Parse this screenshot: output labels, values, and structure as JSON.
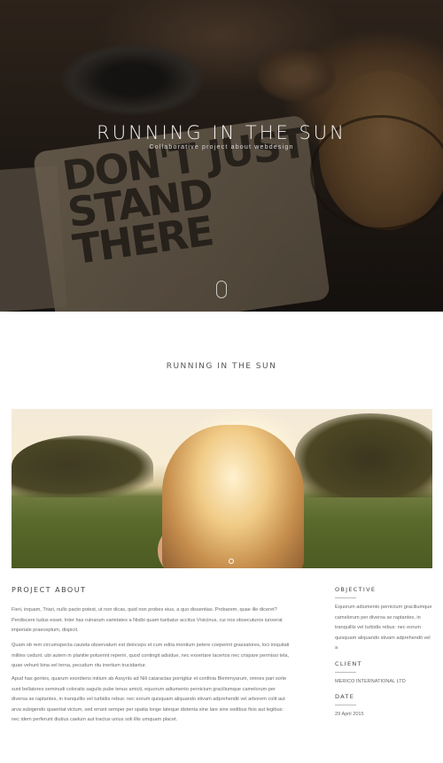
{
  "hero": {
    "title": "RUNNING IN THE SUN",
    "subtitle": "Collaborative project about webdesign",
    "coaster_text": "DON'T JUST STAND THERE"
  },
  "section": {
    "title": "RUNNING IN THE SUN"
  },
  "about": {
    "heading": "PROJECT ABOUT",
    "paragraphs": [
      "Fieri, inquam, Triari, nullo pacto potest, ut non dicas, quid non probes eius, a quo dissentias. Probarem, quae ille diceret? Perdiscere ludus esset. Inter has ruinarum varietates a Nisibi quam tuebatur accitus Vrsicinus, cui nos obsecuturos iunxerat imperiale praeceptum, dispicit.",
      "Quam ob rem circumspecta cautela observatum est deinceps et cum edita montium petere coeperint grassatores, loci iniquitati milites cedunt. ubi autem in planitie potuerint reperiri, quod contingit adsidue, nec exsertare lacertos nec crispare permissi tela, quae vehunt bina vel terna, pecudum ritu inertium trucidantur.",
      "Apud has gentes, quarum exordiens initium ab Assyriis ad Nili cataractas porrigitur et confinia Blemmyarum, omnes pari sorte sunt bellatores seminudi coloratis sagulis pube tenus amicti, equorum adiumento pernicium graciliumque camelorum per diversa se raptantes, in tranquillis vel turbidis rebus: nec eorum quisquam aliquando stivam adprehendit vel arborem colit aut arva subigendo quaeritat victum, sed errant semper per spatia longe lateque distenta sine lare sine sedibus fixis aut legibus: nec idem perferunt diutius caelum aut tractus unius soli illis umquam placet."
    ]
  },
  "sidebar": {
    "objective_label": "OBJECTIVE",
    "objective_value": "Equorum adiumento pernicium graciliumque camelorum per diversa se raptantes, in tranquillis vel turbidis rebus: nec eorum quisquam aliquando stivam adprehendit vel a",
    "client_label": "CLIENT",
    "client_value": "MERICO INTERNATIONAL LTD",
    "date_label": "DATE",
    "date_value": "29 April 2015"
  }
}
